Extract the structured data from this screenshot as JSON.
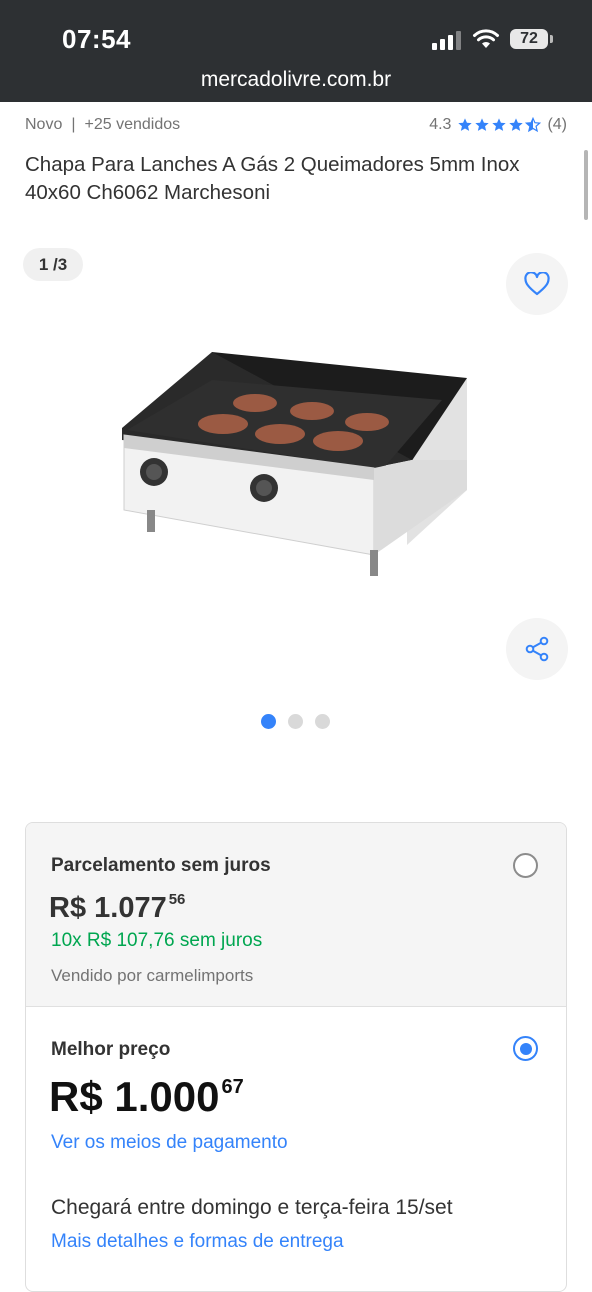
{
  "status": {
    "time": "07:54",
    "battery": "72"
  },
  "browser": {
    "url": "mercadolivre.com.br"
  },
  "product": {
    "condition": "Novo",
    "separator": "|",
    "sold": "+25 vendidos",
    "rating": "4.3",
    "rating_count": "(4)",
    "title": "Chapa Para Lanches A Gás 2 Queimadores 5mm Inox 40x60 Ch6062 Marchesoni",
    "image_counter": "1 /3",
    "image_total": 3,
    "image_current": 1
  },
  "options": {
    "installment": {
      "label": "Parcelamento sem juros",
      "price_main": "R$ 1.077",
      "price_cents": "56",
      "installments": "10x R$ 107,76 sem juros",
      "seller": "Vendido por carmelimports",
      "selected": false
    },
    "best": {
      "label": "Melhor preço",
      "price_main": "R$ 1.000",
      "price_cents": "67",
      "payment_link": "Ver os meios de pagamento",
      "delivery": "Chegará entre domingo e terça-feira 15/set",
      "delivery_link": "Mais detalhes e formas de entrega",
      "selected": true
    }
  },
  "colors": {
    "accent": "#3483fa",
    "green": "#00a650",
    "status_bg": "#2d3033"
  }
}
